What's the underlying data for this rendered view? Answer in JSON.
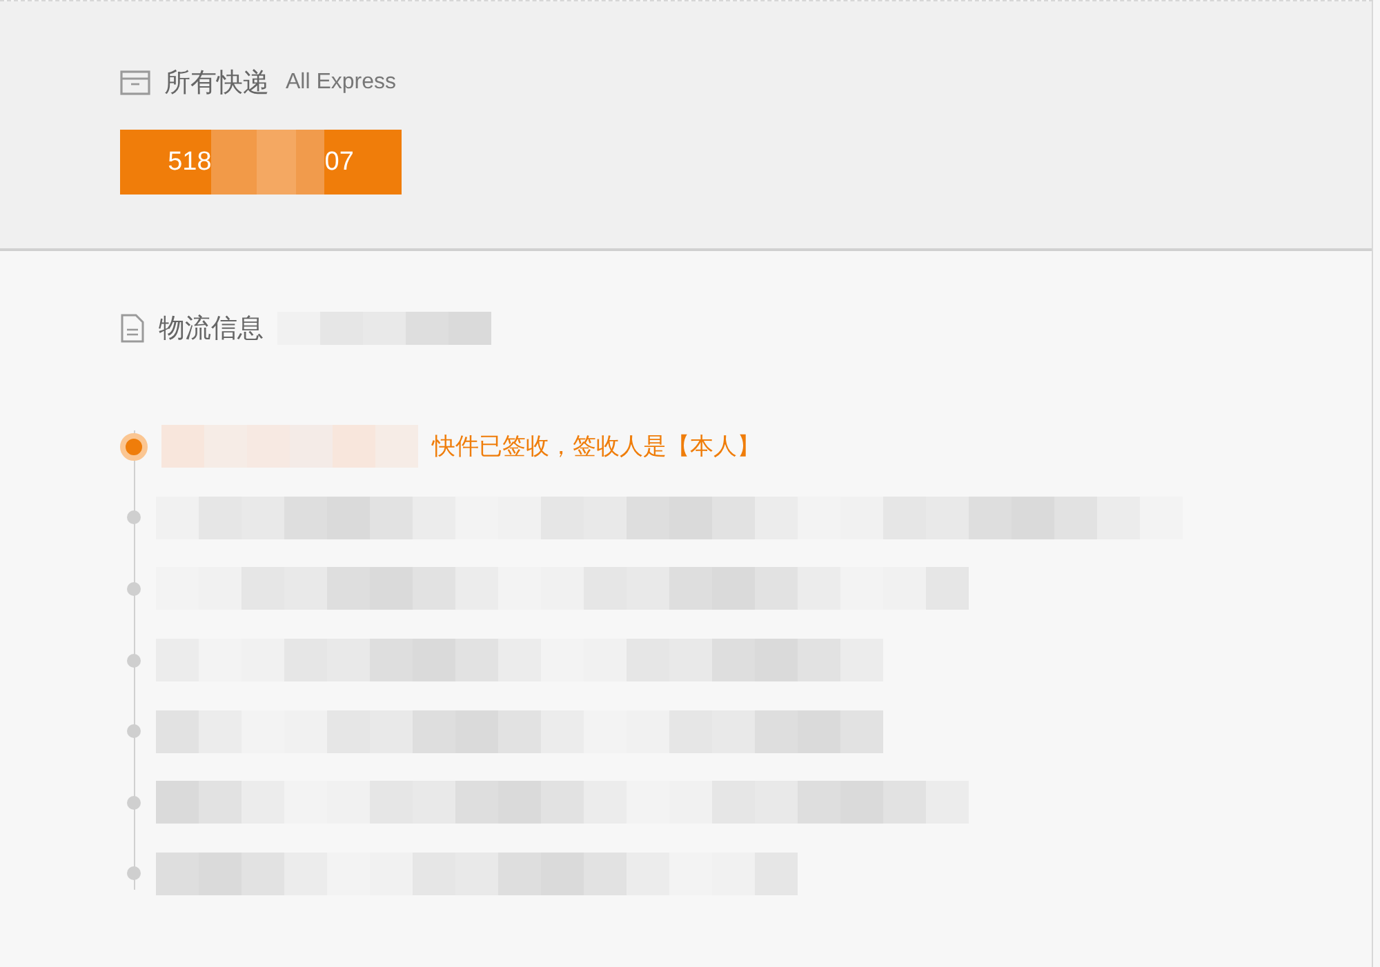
{
  "express_panel": {
    "title": "所有快递",
    "subtitle": "All Express",
    "tracking_button": {
      "prefix": "518",
      "suffix": "07",
      "selected": true
    }
  },
  "logistics": {
    "title": "物流信息",
    "events": [
      {
        "text": "快件已签收，签收人是【本人】",
        "current": true
      },
      {
        "current": false
      },
      {
        "current": false
      },
      {
        "current": false
      },
      {
        "current": false
      },
      {
        "current": false
      },
      {
        "current": false
      }
    ]
  }
}
